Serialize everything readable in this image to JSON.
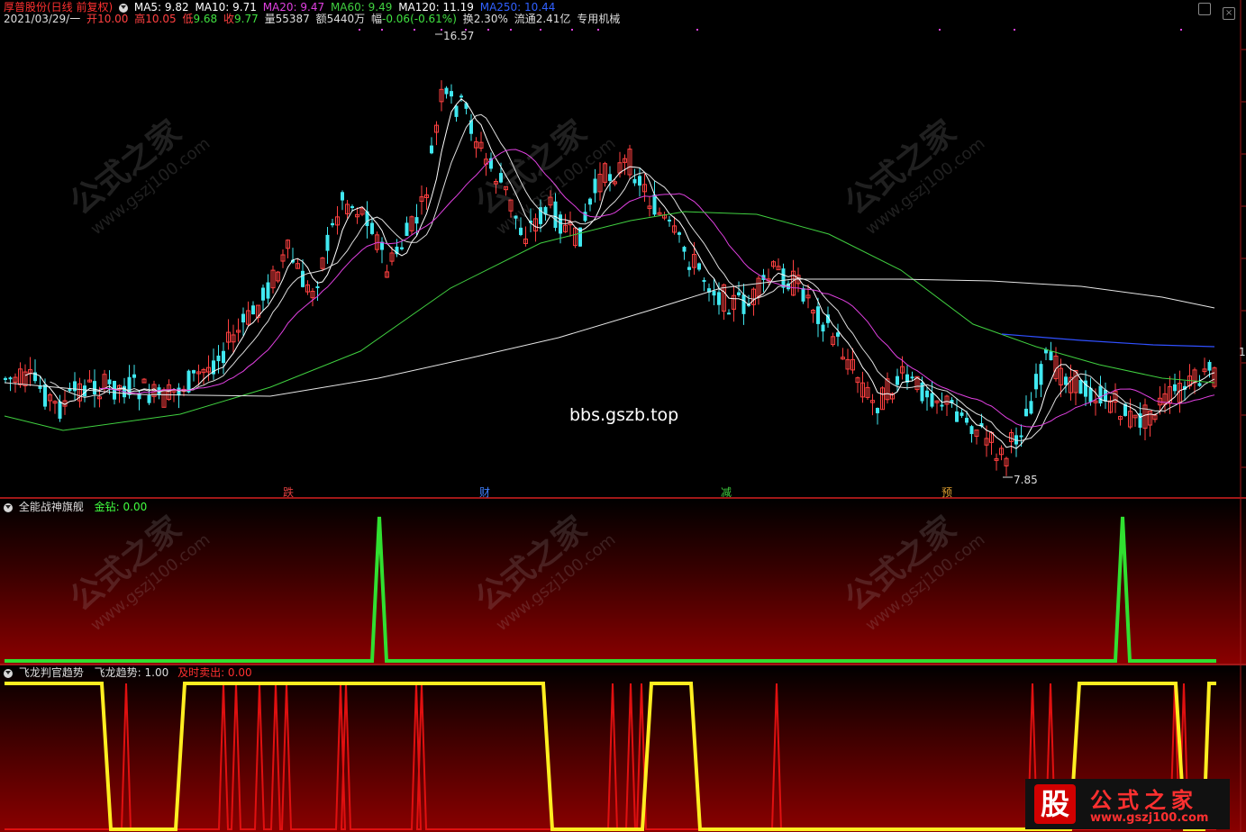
{
  "header": {
    "stock": "厚普股份(日线 前复权)",
    "ma": [
      {
        "label": "MA5: 9.82",
        "color": "#ffffff"
      },
      {
        "label": "MA10: 9.71",
        "color": "#ffffff"
      },
      {
        "label": "MA20: 9.47",
        "color": "#e040e0"
      },
      {
        "label": "MA60: 9.49",
        "color": "#40d040"
      },
      {
        "label": "MA120: 11.19",
        "color": "#ffffff"
      },
      {
        "label": "MA250: 10.44",
        "color": "#3060ff"
      }
    ],
    "date": "2021/03/29/一",
    "open_label": "开",
    "open": "10.00",
    "high_label": "高",
    "high": "10.05",
    "low_label": "低",
    "low": "9.68",
    "close_label": "收",
    "close": "9.77",
    "vol_label": "量",
    "vol": "55387",
    "amt_label": "额",
    "amt": "5440万",
    "chg_label": "幅",
    "chg": "-0.06(-0.61%)",
    "turn_label": "换",
    "turn": "2.30%",
    "float_label": "流通",
    "float": "2.41亿",
    "sector": "专用机械"
  },
  "price_labels": {
    "high": "16.57",
    "low": "7.85",
    "right_tick": "1"
  },
  "center_text": "bbs.gszb.top",
  "event_tags": [
    {
      "text": "跌",
      "color": "#e04040"
    },
    {
      "text": "财",
      "color": "#4080ff"
    },
    {
      "text": "减",
      "color": "#40d040"
    },
    {
      "text": "预",
      "color": "#e0a030"
    }
  ],
  "indicator1": {
    "name": "全能战神旗舰",
    "label": "金钻: 0.00",
    "color": "#40ff40"
  },
  "indicator2": {
    "name": "飞龙判官趋势",
    "label1": "飞龙趋势: 1.00",
    "label2": "及时卖出: 0.00",
    "color2": "#ff3030"
  },
  "watermark": {
    "title": "公式之家",
    "url": "www.gszj100.com"
  },
  "logo": {
    "glyph": "股",
    "text": "公式之家",
    "url": "www.gszj100.com"
  },
  "colors": {
    "up": "#ff4040",
    "down": "#40e8f0",
    "ma5": "#ffffff",
    "ma20": "#e040e0",
    "ma60": "#40d040",
    "ma120": "#e6e6e6",
    "ma250": "#3050ff"
  }
}
